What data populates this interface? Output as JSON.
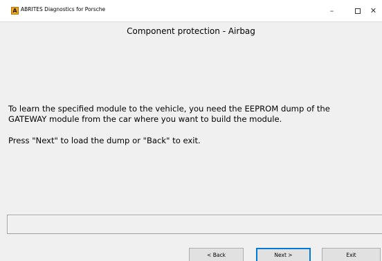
{
  "window": {
    "app_icon_letter": "A",
    "title": "ABRITES Diagnostics for Porsche",
    "minimize_glyph": "–",
    "close_glyph": "✕"
  },
  "main": {
    "heading": "Component protection - Airbag",
    "line1": "To learn the specified module to the vehicle, you need the EEPROM dump of the",
    "line2": "GATEWAY module from the car where you want to build the module.",
    "line3": "Press \"Next\" to load the dump or \"Back\" to exit.",
    "status_text": ""
  },
  "buttons": {
    "back": "< Back",
    "next": "Next >",
    "exit": "Exit"
  }
}
